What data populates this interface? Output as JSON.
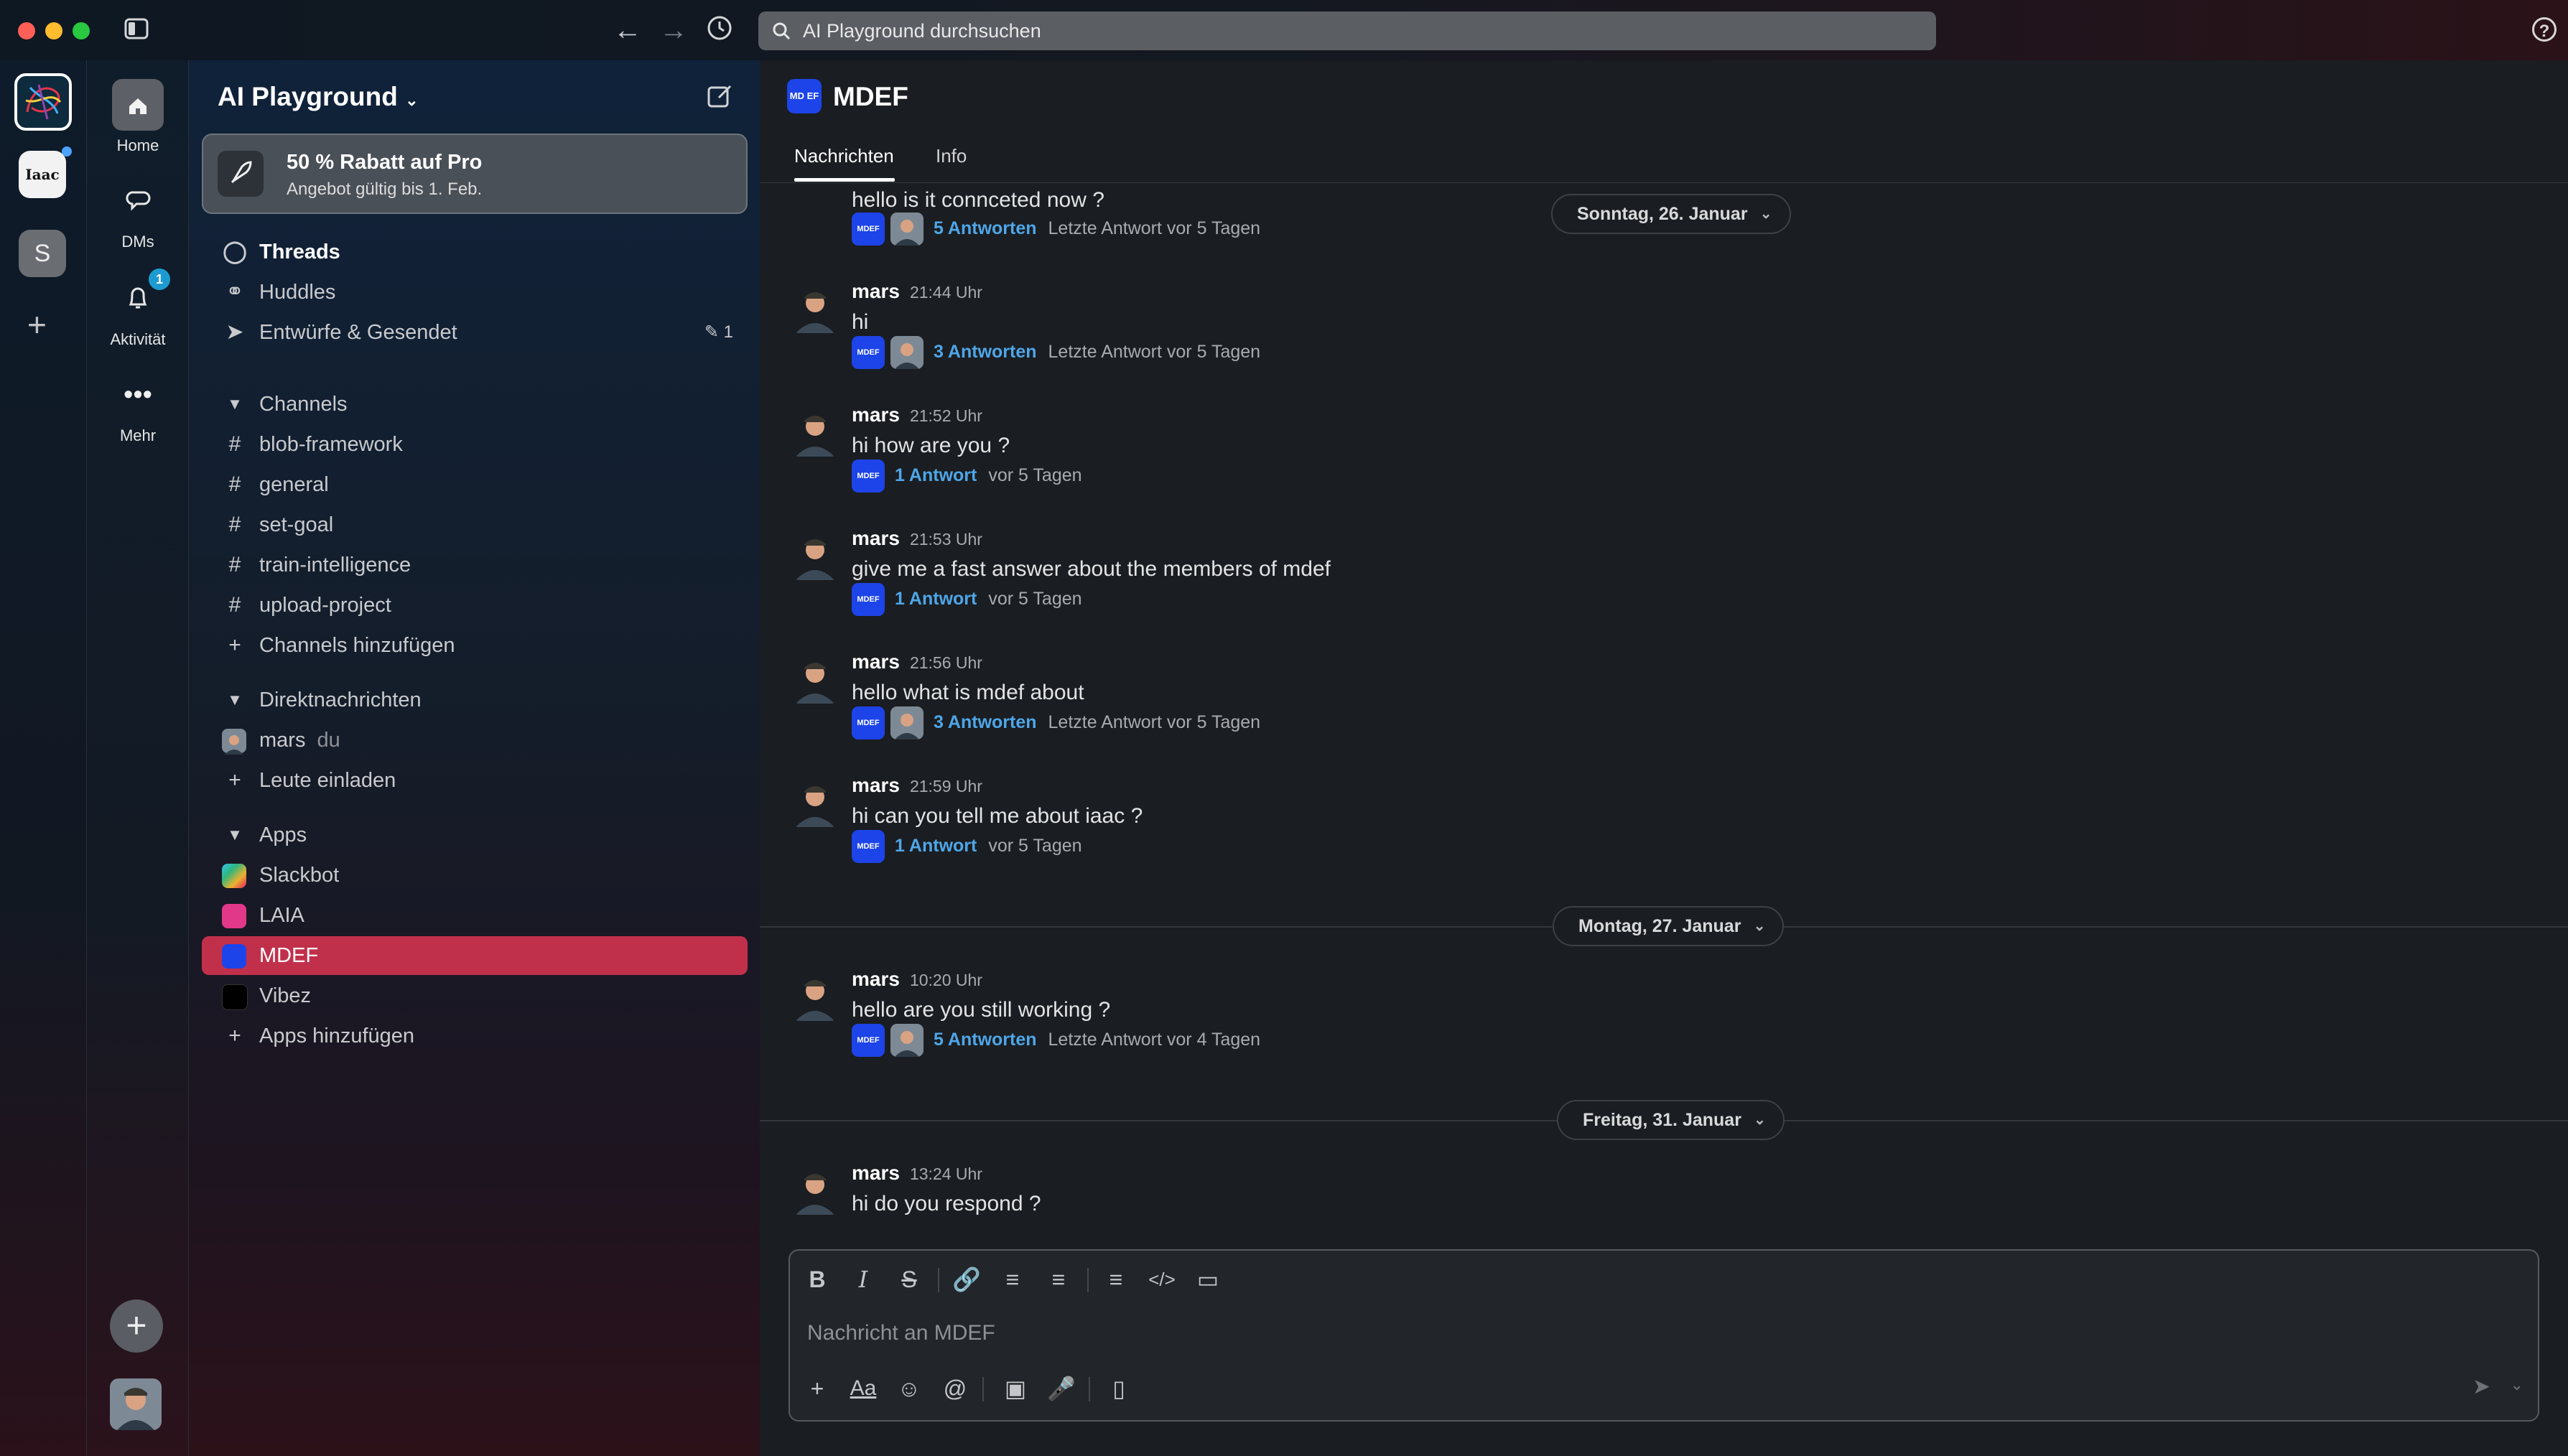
{
  "window": {
    "search_placeholder": "AI Playground durchsuchen",
    "help_label": "?"
  },
  "rail": {
    "workspaces": [
      {
        "name": "AI Playground"
      },
      {
        "label": "Iaac"
      },
      {
        "label": "S"
      }
    ],
    "add_label": "+"
  },
  "nav": {
    "home": "Home",
    "dms": "DMs",
    "activity": "Aktivität",
    "activity_badge": "1",
    "more": "Mehr"
  },
  "sidebar": {
    "workspace_name": "AI Playground",
    "promo": {
      "title": "50 % Rabatt auf Pro",
      "subtitle": "Angebot gültig bis 1. Feb."
    },
    "top_items": [
      {
        "label": "Threads"
      },
      {
        "label": "Huddles"
      },
      {
        "label": "Entwürfe & Gesendet",
        "count": "1"
      }
    ],
    "channels_header": "Channels",
    "channels": [
      "blob-framework",
      "general",
      "set-goal",
      "train-intelligence",
      "upload-project"
    ],
    "add_channels": "Channels hinzufügen",
    "dm_header": "Direktnachrichten",
    "dms": [
      {
        "name": "mars",
        "suffix": "du"
      }
    ],
    "invite": "Leute einladen",
    "apps_header": "Apps",
    "apps": [
      "Slackbot",
      "LAIA",
      "MDEF",
      "Vibez"
    ],
    "add_apps": "Apps hinzufügen"
  },
  "channel": {
    "name": "MDEF",
    "icon_text": "MD EF",
    "tabs": [
      "Nachrichten",
      "Info"
    ]
  },
  "messages": [
    {
      "author": "",
      "time": "",
      "text": "hello is it connceted now ?",
      "replies": "5 Antworten",
      "reply_meta": "Letzte Antwort vor 5 Tagen"
    },
    {
      "author": "mars",
      "time": "21:44 Uhr",
      "text": "hi",
      "replies": "3 Antworten",
      "reply_meta": "Letzte Antwort vor 5 Tagen"
    },
    {
      "author": "mars",
      "time": "21:52 Uhr",
      "text": "hi how are you ?",
      "replies": "1 Antwort",
      "reply_meta": "vor 5 Tagen"
    },
    {
      "author": "mars",
      "time": "21:53 Uhr",
      "text": "give me a fast answer about the members of mdef",
      "replies": "1 Antwort",
      "reply_meta": "vor 5 Tagen"
    },
    {
      "author": "mars",
      "time": "21:56 Uhr",
      "text": "hello what is mdef about",
      "replies": "3 Antworten",
      "reply_meta": "Letzte Antwort vor 5 Tagen"
    },
    {
      "author": "mars",
      "time": "21:59 Uhr",
      "text": "hi can you tell me about iaac ?",
      "replies": "1 Antwort",
      "reply_meta": "vor 5 Tagen"
    },
    {
      "author": "mars",
      "time": "10:20 Uhr",
      "text": "hello are you still working ?",
      "replies": "5 Antworten",
      "reply_meta": "Letzte Antwort vor 4 Tagen"
    },
    {
      "author": "mars",
      "time": "13:24 Uhr",
      "text": "hi do you respond ?"
    }
  ],
  "dates": [
    "Sonntag, 26. Januar",
    "Montag, 27. Januar",
    "Freitag, 31. Januar"
  ],
  "composer": {
    "placeholder": "Nachricht an MDEF",
    "format_label": "Aa"
  },
  "colors": {
    "accent": "#c1304b",
    "link": "#4ea6e8",
    "bot": "#1d44e8"
  }
}
